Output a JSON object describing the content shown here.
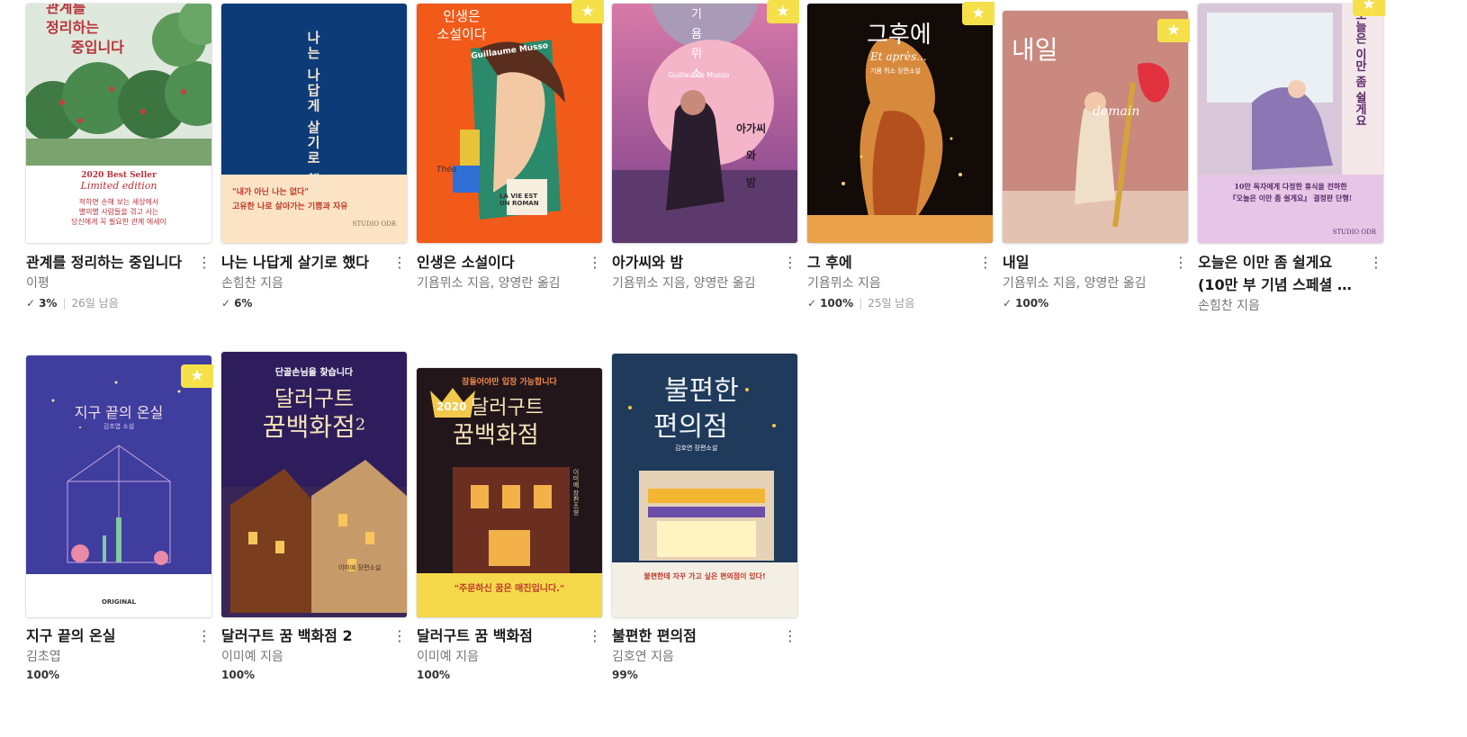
{
  "books": [
    {
      "title": "관계를 정리하는 중입니다",
      "author": "이평",
      "progress": "3%",
      "remaining": "26일 남음",
      "starred": false,
      "cover_text": [
        "관계를",
        "정리하는",
        "중입니다",
        "2020 Best Seller",
        "Limited edition",
        "적하면 손해 보는 세상에서",
        "별의별 사람들을 겪고 사는",
        "당신에게 꼭 필요한 관계 에세이"
      ]
    },
    {
      "title": "나는 나답게 살기로 했다",
      "author": "손힘찬 지음",
      "progress": "6%",
      "remaining": "",
      "starred": false,
      "cover_text": [
        "나는 나답게 살기로 했다",
        "\"내가 아닌 나는 없다\"",
        "고유한 나로 살아가는 기쁨과 자유",
        "STUDIO ODR"
      ]
    },
    {
      "title": "인생은 소설이다",
      "author": "기욤뮈소 지음, 양영란 옮김",
      "progress": "",
      "remaining": "",
      "starred": true,
      "cover_text": [
        "인생은",
        "소설이다",
        "Guillaume Musso",
        "Théo",
        "LA VIE EST UN ROMAN"
      ]
    },
    {
      "title": "아가씨와 밤",
      "author": "기욤뮈소 지음, 양영란 옮김",
      "progress": "",
      "remaining": "",
      "starred": true,
      "cover_text": [
        "기",
        "욤",
        "뮈",
        "소",
        "Guillaume Musso",
        "아가씨",
        "와",
        "밤"
      ]
    },
    {
      "title": "그 후에",
      "author": "기욤뮈소 지음",
      "progress": "100%",
      "remaining": "25일 남음",
      "starred": true,
      "cover_text": [
        "그후에",
        "Et après...",
        "기욤 뮈소 장편소설"
      ]
    },
    {
      "title": "내일",
      "author": "기욤뮈소 지음, 양영란 옮김",
      "progress": "100%",
      "remaining": "",
      "starred": true,
      "cover_text": [
        "내일",
        "demain"
      ]
    },
    {
      "title": "오늘은 이만 좀 쉴게요 (10만 부 기념 스페셜 …",
      "author": "손힘찬 지음",
      "progress": "",
      "remaining": "",
      "starred": true,
      "cover_text": [
        "오늘은 이만 좀 쉴게요",
        "10만 독자에게 다정한 휴식을 전하한",
        "『오늘은 이만 좀 쉴게요』 결정판 단행!",
        "STUDIO ODR"
      ]
    },
    {
      "title": "지구 끝의 온실",
      "author": "김초엽",
      "progress": "100%",
      "remaining": "",
      "starred": true,
      "cover_text": [
        "지구 끝의 온실",
        "김초엽 소설",
        "ORIGINAL"
      ]
    },
    {
      "title": "달러구트 꿈 백화점 2",
      "author": "이미예 지음",
      "progress": "100%",
      "remaining": "",
      "starred": false,
      "cover_text": [
        "단골손님을 찾습니다",
        "달러구트",
        "꿈백화점",
        "2",
        "이미예 장편소설"
      ]
    },
    {
      "title": "달러구트 꿈 백화점",
      "author": "이미예 지음",
      "progress": "100%",
      "remaining": "",
      "starred": false,
      "cover_text": [
        "잠들어야만 입장 가능합니다",
        "2020",
        "달러구트",
        "꿈백화점",
        "\"주문하신 꿈은 매진입니다.\"",
        "이미예 장편소설"
      ]
    },
    {
      "title": "불편한 편의점",
      "author": "김호연 지음",
      "progress": "99%",
      "remaining": "",
      "starred": false,
      "cover_text": [
        "불편한",
        "편의점",
        "김호연 장편소설",
        "불편한데 자꾸 가고 싶은 편의점이 있다!"
      ]
    }
  ],
  "icons": {
    "more": "more-vertical-icon",
    "star": "star-icon",
    "check": "check-icon"
  },
  "colors": {
    "star_badge": "#f6e04a",
    "title": "#1a1a1a",
    "author": "#777777"
  }
}
